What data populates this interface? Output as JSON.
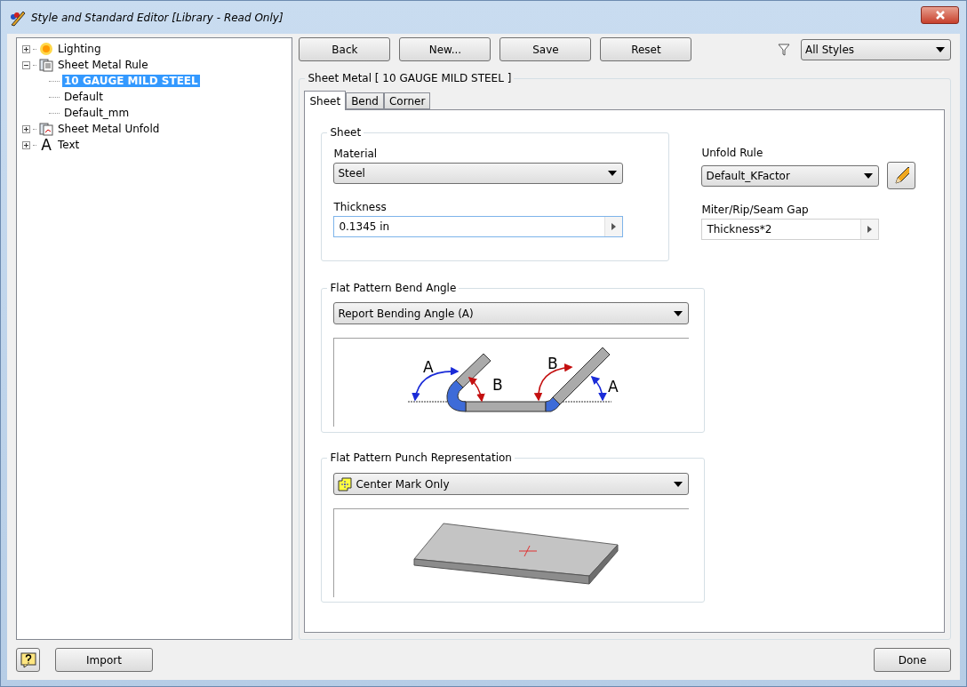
{
  "window": {
    "title": "Style and Standard Editor [Library - Read Only]"
  },
  "tree": [
    {
      "label": "Lighting",
      "kind": "sun",
      "expanded": false,
      "selected": false
    },
    {
      "label": "Sheet Metal Rule",
      "kind": "rule",
      "expanded": true,
      "selected": false,
      "children": [
        {
          "label": "10 GAUGE MILD STEEL",
          "selected": true
        },
        {
          "label": "Default",
          "selected": false
        },
        {
          "label": "Default_mm",
          "selected": false
        }
      ]
    },
    {
      "label": "Sheet Metal Unfold",
      "kind": "unfold",
      "expanded": false,
      "selected": false
    },
    {
      "label": "Text",
      "kind": "glyph",
      "glyph": "A",
      "expanded": false,
      "selected": false
    }
  ],
  "toolbar": {
    "buttons": [
      "Back",
      "New...",
      "Save",
      "Reset"
    ],
    "filter": {
      "value": "All Styles"
    }
  },
  "style_group": {
    "title": "Sheet Metal [ 10 GAUGE MILD STEEL ]"
  },
  "tabs": [
    {
      "label": "Sheet",
      "selected": true
    },
    {
      "label": "Bend",
      "selected": false
    },
    {
      "label": "Corner",
      "selected": false
    }
  ],
  "sheet": {
    "title": "Sheet",
    "material": {
      "label": "Material",
      "value": "Steel"
    },
    "thickness": {
      "label": "Thickness",
      "value": "0.1345 in"
    }
  },
  "unfold_rule": {
    "label": "Unfold Rule",
    "value": "Default_KFactor"
  },
  "gap": {
    "label": "Miter/Rip/Seam Gap",
    "value": "Thickness*2"
  },
  "bend_angle": {
    "title": "Flat Pattern Bend Angle",
    "value": "Report Bending Angle (A)",
    "labels": [
      "A",
      "B",
      "B",
      "A"
    ]
  },
  "punch": {
    "title": "Flat Pattern Punch Representation",
    "value": "Center Mark Only"
  },
  "footer": {
    "import": "Import",
    "done": "Done"
  }
}
